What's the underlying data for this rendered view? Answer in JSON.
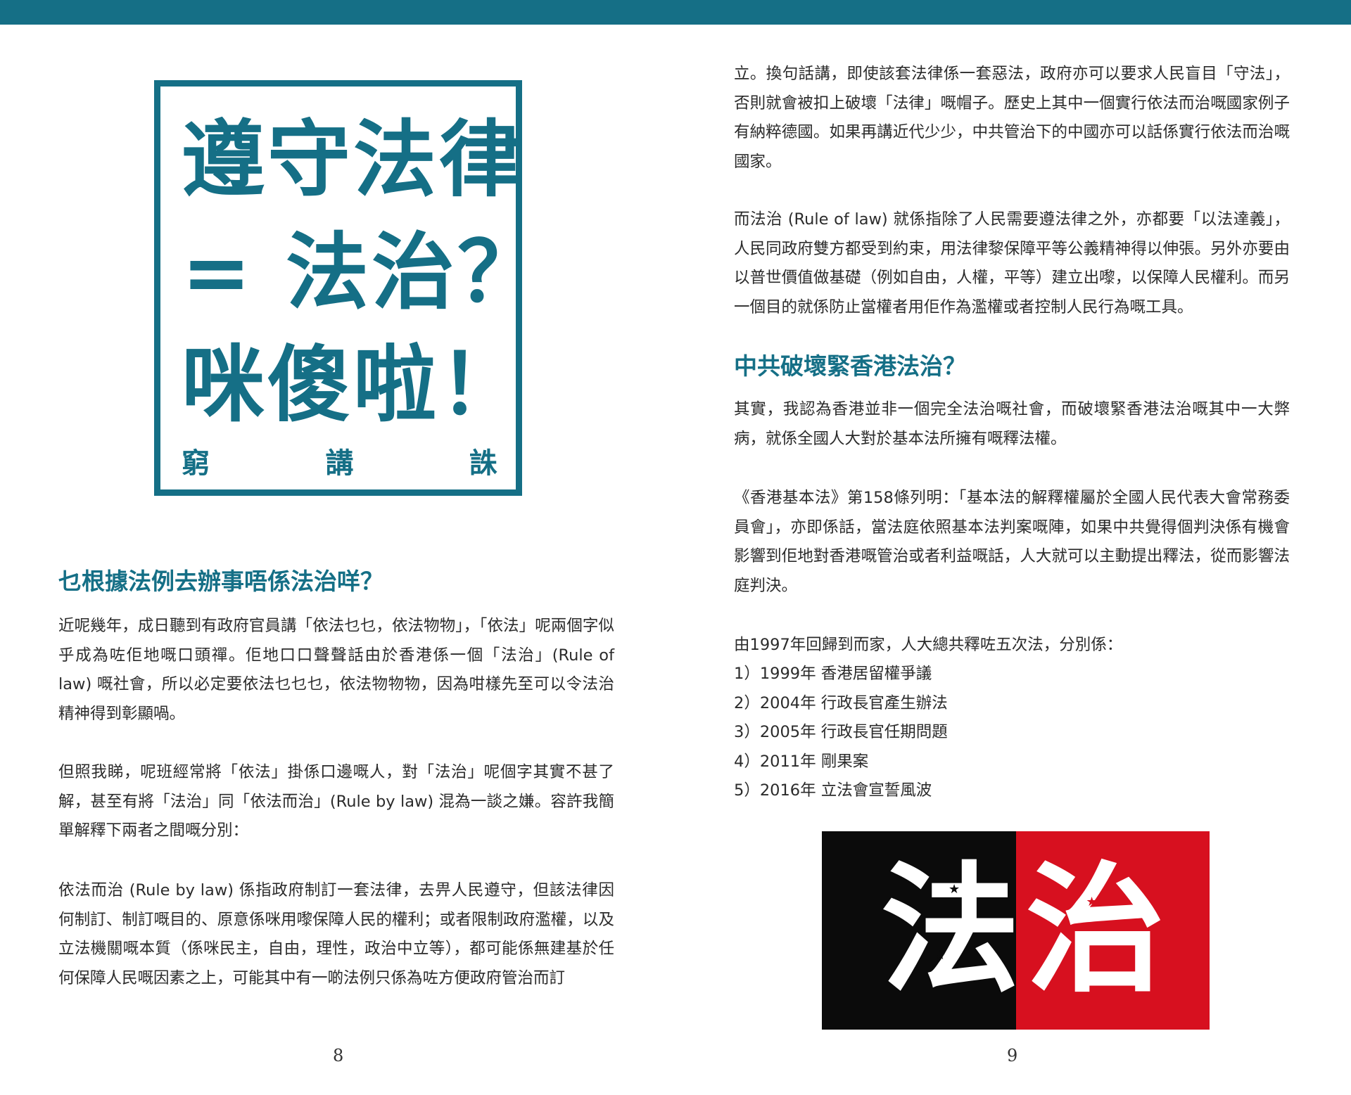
{
  "title_box": {
    "line1": "遵守法律",
    "line2": "= 法治？",
    "line3": "咪傻啦！",
    "byline": [
      "窮",
      "講",
      "誅"
    ]
  },
  "left_page": {
    "heading": "乜根據法例去辦事唔係法治咩？",
    "paragraphs": [
      "近呢幾年，成日聽到有政府官員講「依法乜乜，依法物物」，「依法」呢兩個字似乎成為咗佢地嘅口頭禪。佢地口口聲聲話由於香港係一個「法治」(Rule of law) 嘅社會，所以必定要依法乜乜乜，依法物物物，因為咁樣先至可以令法治精神得到彰顯喎。",
      "但照我睇，呢班經常將「依法」掛係口邊嘅人，對「法治」呢個字其實不甚了解，甚至有將「法治」同「依法而治」(Rule by law) 混為一談之嫌。容許我簡單解釋下兩者之間嘅分別：",
      "依法而治 (Rule by law) 係指政府制訂一套法律，去畀人民遵守，但該法律因何制訂、制訂嘅目的、原意係咪用嚟保障人民的權利；或者限制政府濫權，以及立法機關嘅本質（係咪民主，自由，理性，政治中立等），都可能係無建基於任何保障人民嘅因素之上，可能其中有一啲法例只係為咗方便政府管治而訂"
    ],
    "page_number": "8"
  },
  "right_page": {
    "paragraphs_top": [
      "立。換句話講，即使該套法律係一套惡法，政府亦可以要求人民盲目「守法」，否則就會被扣上破壞「法律」嘅帽子。歷史上其中一個實行依法而治嘅國家例子有納粹德國。如果再講近代少少，中共管治下的中國亦可以話係實行依法而治嘅國家。",
      "而法治 (Rule of law) 就係指除了人民需要遵法律之外，亦都要「以法達義」，人民同政府雙方都受到約束，用法律黎保障平等公義精神得以伸張。另外亦要由以普世價值做基礎（例如自由，人權，平等）建立出嚟，以保障人民權利。而另一個目的就係防止當權者用佢作為濫權或者控制人民行為嘅工具。"
    ],
    "heading": "中共破壞緊香港法治？",
    "paragraphs_bottom": [
      "其實，我認為香港並非一個完全法治嘅社會，而破壞緊香港法治嘅其中一大弊病，就係全國人大對於基本法所擁有嘅釋法權。",
      "《香港基本法》第158條列明：「基本法的解釋權屬於全國人民代表大會常務委員會」，亦即係話，當法庭依照基本法判案嘅陣，如果中共覺得個判決係有機會影響到佢地對香港嘅管治或者利益嘅話，人大就可以主動提出釋法，從而影響法庭判決。"
    ],
    "list_intro": "由1997年回歸到而家，人大總共釋咗五次法，分別係：",
    "list_items": [
      "1）1999年 香港居留權爭議",
      "2）2004年 行政長官產生辦法",
      "3）2005年 行政長官任期問題",
      "4）2011年 剛果案",
      "5）2016年 立法會宣誓風波"
    ],
    "flag_image": {
      "left_char": "法",
      "right_char": "治"
    },
    "page_number": "9"
  }
}
